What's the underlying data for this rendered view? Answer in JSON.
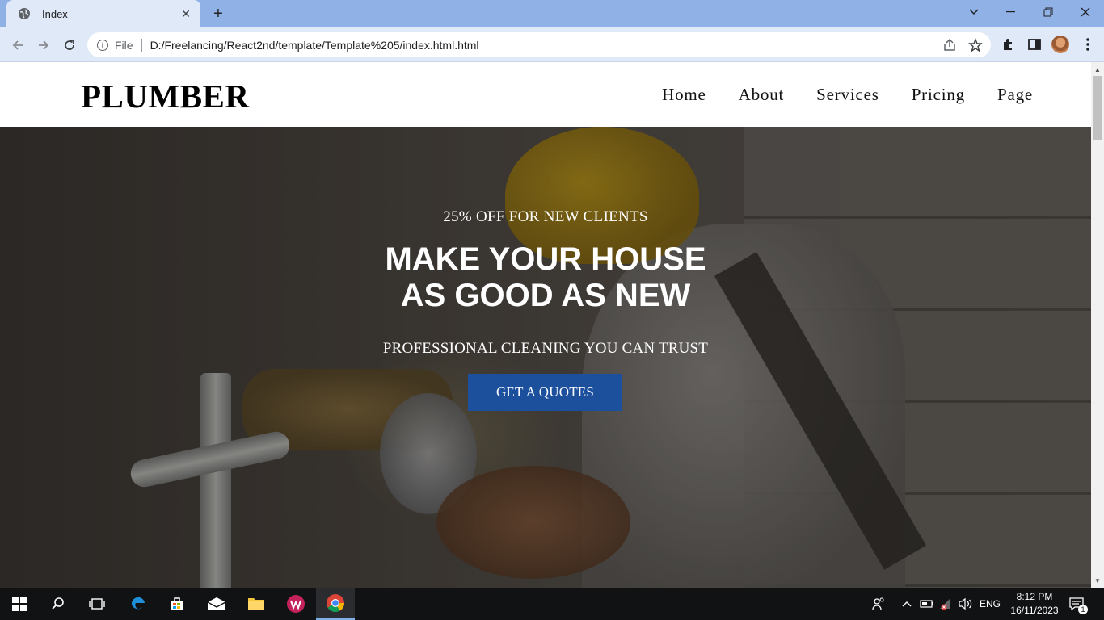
{
  "browser": {
    "tab_title": "Index",
    "address_scheme": "File",
    "address_url": "D:/Freelancing/React2nd/template/Template%205/index.html.html"
  },
  "site": {
    "logo": "PLUMBER",
    "nav": [
      "Home",
      "About",
      "Services",
      "Pricing",
      "Page"
    ]
  },
  "hero": {
    "offer": "25% OFF FOR NEW CLIENTS",
    "headline_line1": "MAKE YOUR HOUSE",
    "headline_line2": "AS GOOD AS NEW",
    "tagline": "PROFESSIONAL CLEANING YOU CAN TRUST",
    "cta_label": "GET A QUOTES"
  },
  "taskbar": {
    "language": "ENG",
    "time": "8:12 PM",
    "date": "16/11/2023",
    "notification_count": "1"
  },
  "colors": {
    "tabbar": "#8fb1e6",
    "toolbar": "#dfe9f7",
    "cta": "#1c4f9c",
    "taskbar": "#111214"
  }
}
